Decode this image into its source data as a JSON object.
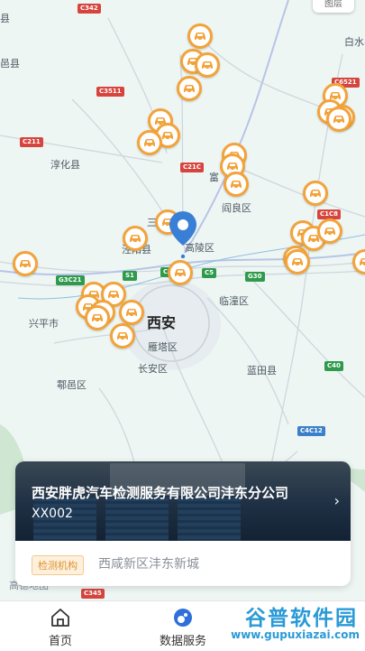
{
  "map": {
    "layers_label": "图层",
    "place_labels": [
      "白水县",
      "淳化县",
      "阎良区",
      "富",
      "三",
      "泾阳县",
      "高陵区",
      "临潼区",
      "兴平市",
      "西安",
      "雁塔区",
      "长安区",
      "蓝田县",
      "鄠邑区",
      "县",
      "邑县"
    ],
    "road_shields": [
      "C342",
      "C6521",
      "C3511",
      "C211",
      "C21C",
      "C1C8",
      "S1",
      "C6",
      "C5",
      "G30",
      "G3C21",
      "C40",
      "C4C12",
      "C345"
    ],
    "logo_text": "高德地图",
    "pin_icon": "car-icon",
    "marker_color": "#f2a33a",
    "location_color": "#3a7fd6"
  },
  "card": {
    "title": "西安胖虎汽车检测服务有限公司沣东分公司",
    "code": "XX002",
    "tag": "检测机构",
    "address": "西咸新区沣东新城"
  },
  "tabs": [
    {
      "label": "首页",
      "icon": "home-icon"
    },
    {
      "label": "数据服务",
      "icon": "data-service-icon"
    }
  ],
  "watermark": {
    "logo": "谷普软件园",
    "url": "www.gupuxiazai.com"
  }
}
